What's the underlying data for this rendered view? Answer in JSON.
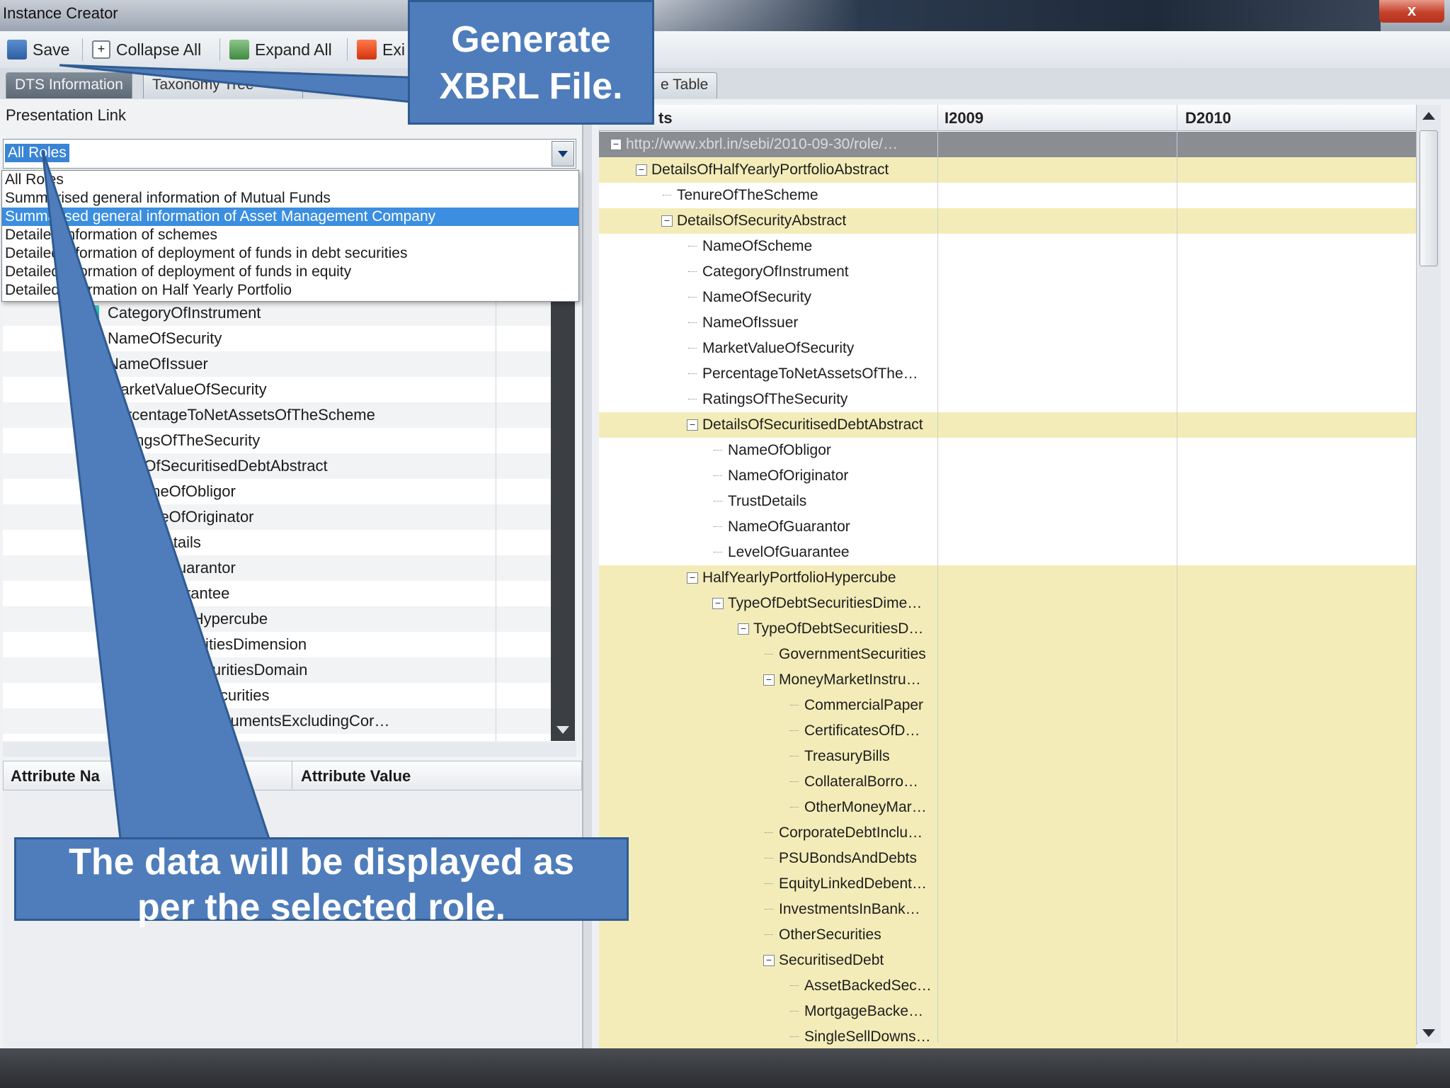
{
  "window": {
    "title": "Instance Creator",
    "close_glyph": "x"
  },
  "toolbar": {
    "save_label": "Save",
    "collapse_label": "Collapse All",
    "expand_label": "Expand All",
    "exit_label": "Exi"
  },
  "tabs": [
    {
      "label": "DTS Information"
    },
    {
      "label": "Taxonomy Tree"
    },
    {
      "label": "e Table"
    }
  ],
  "left": {
    "presentation_link_label": "Presentation Link",
    "roles_selected": "All Roles",
    "role_options": [
      "All Roles",
      "Summarised general information of Mutual Funds",
      "Summarised general information of Asset Management Company",
      "Detailed information of schemes",
      "Detailed information of deployment of funds in debt securities",
      "Detailed information of deployment of funds in equity",
      "Detailed information on Half Yearly Portfolio"
    ],
    "tree_rows": [
      {
        "label": "CategoryOfInstrument",
        "icon": true
      },
      {
        "label": "NameOfSecurity",
        "icon": true
      },
      {
        "label": "NameOfIssuer",
        "icon": true
      },
      {
        "label": "MarketValueOfSecurity",
        "icon": true
      },
      {
        "label": "PercentageToNetAssetsOfTheScheme",
        "icon": false
      },
      {
        "label": "RatingsOfTheSecurity",
        "icon": false
      },
      {
        "label": "etailsOfSecuritisedDebtAbstract",
        "icon": false
      },
      {
        "label": "NameOfObligor",
        "icon": false
      },
      {
        "label": "NameOfOriginator",
        "icon": false
      },
      {
        "label": "rustDetails",
        "icon": false
      },
      {
        "label": "meOfGuarantor",
        "icon": false
      },
      {
        "label": "elOfGuarantee",
        "icon": false
      },
      {
        "label": "yPortfolioHypercube",
        "icon": false
      },
      {
        "label": "fDebtSecuritiesDimension",
        "icon": false
      },
      {
        "label": "eOfDebtSecuritiesDomain",
        "icon": false
      },
      {
        "label": "overnmentSecurities",
        "icon": false
      },
      {
        "label": "neyMarketInstrumentsExcludingCor…",
        "icon": false
      }
    ],
    "attr_name_header": "Attribute Na",
    "attr_value_header": "Attribute Value"
  },
  "grid": {
    "col_elements": "ts",
    "col_i2009": "I2009",
    "col_d2010": "D2010",
    "rows": [
      {
        "label": "http://www.xbrl.in/sebi/2010-09-30/role/…",
        "style": "url",
        "expander": "-"
      },
      {
        "label": "DetailsOfHalfYearlyPortfolioAbstract",
        "style": "yellow",
        "expander": "-"
      },
      {
        "label": "TenureOfTheScheme",
        "style": "white",
        "expander": ""
      },
      {
        "label": "DetailsOfSecurityAbstract",
        "style": "yellow",
        "expander": "-"
      },
      {
        "label": "NameOfScheme",
        "style": "white",
        "expander": ""
      },
      {
        "label": "CategoryOfInstrument",
        "style": "white",
        "expander": ""
      },
      {
        "label": "NameOfSecurity",
        "style": "white",
        "expander": ""
      },
      {
        "label": "NameOfIssuer",
        "style": "white",
        "expander": ""
      },
      {
        "label": "MarketValueOfSecurity",
        "style": "white",
        "expander": ""
      },
      {
        "label": "PercentageToNetAssetsOfThe…",
        "style": "white",
        "expander": ""
      },
      {
        "label": "RatingsOfTheSecurity",
        "style": "white",
        "expander": ""
      },
      {
        "label": "DetailsOfSecuritisedDebtAbstract",
        "style": "yellow",
        "expander": "-"
      },
      {
        "label": "NameOfObligor",
        "style": "white",
        "expander": ""
      },
      {
        "label": "NameOfOriginator",
        "style": "white",
        "expander": ""
      },
      {
        "label": "TrustDetails",
        "style": "white",
        "expander": ""
      },
      {
        "label": "NameOfGuarantor",
        "style": "white",
        "expander": ""
      },
      {
        "label": "LevelOfGuarantee",
        "style": "white",
        "expander": ""
      },
      {
        "label": "HalfYearlyPortfolioHypercube",
        "style": "yellow",
        "expander": "-"
      },
      {
        "label": "TypeOfDebtSecuritiesDime…",
        "style": "yellow",
        "expander": "-"
      },
      {
        "label": "TypeOfDebtSecuritiesD…",
        "style": "yellow",
        "expander": "-"
      },
      {
        "label": "GovernmentSecurities",
        "style": "yellow",
        "expander": ""
      },
      {
        "label": "MoneyMarketInstru…",
        "style": "yellow",
        "expander": "-"
      },
      {
        "label": "CommercialPaper",
        "style": "yellow",
        "expander": ""
      },
      {
        "label": "CertificatesOfD…",
        "style": "yellow",
        "expander": ""
      },
      {
        "label": "TreasuryBills",
        "style": "yellow",
        "expander": ""
      },
      {
        "label": "CollateralBorro…",
        "style": "yellow",
        "expander": ""
      },
      {
        "label": "OtherMoneyMar…",
        "style": "yellow",
        "expander": ""
      },
      {
        "label": "CorporateDebtInclu…",
        "style": "yellow",
        "expander": ""
      },
      {
        "label": "PSUBondsAndDebts",
        "style": "yellow",
        "expander": ""
      },
      {
        "label": "EquityLinkedDebent…",
        "style": "yellow",
        "expander": ""
      },
      {
        "label": "InvestmentsInBank…",
        "style": "yellow",
        "expander": ""
      },
      {
        "label": "OtherSecurities",
        "style": "yellow",
        "expander": ""
      },
      {
        "label": "SecuritisedDebt",
        "style": "yellow",
        "expander": "-"
      },
      {
        "label": "AssetBackedSec…",
        "style": "yellow",
        "expander": ""
      },
      {
        "label": "MortgageBacke…",
        "style": "yellow",
        "expander": ""
      },
      {
        "label": "SingleSellDowns…",
        "style": "yellow",
        "expander": ""
      }
    ]
  },
  "callouts": {
    "top": [
      "Generate",
      "XBRL File."
    ],
    "bottom": [
      "The data will be displayed as",
      "per the selected role."
    ]
  },
  "colors": {
    "callout_fill": "#4f7dbb",
    "highlight_row": "#f4ecb8",
    "selection": "#3b8ee0"
  }
}
